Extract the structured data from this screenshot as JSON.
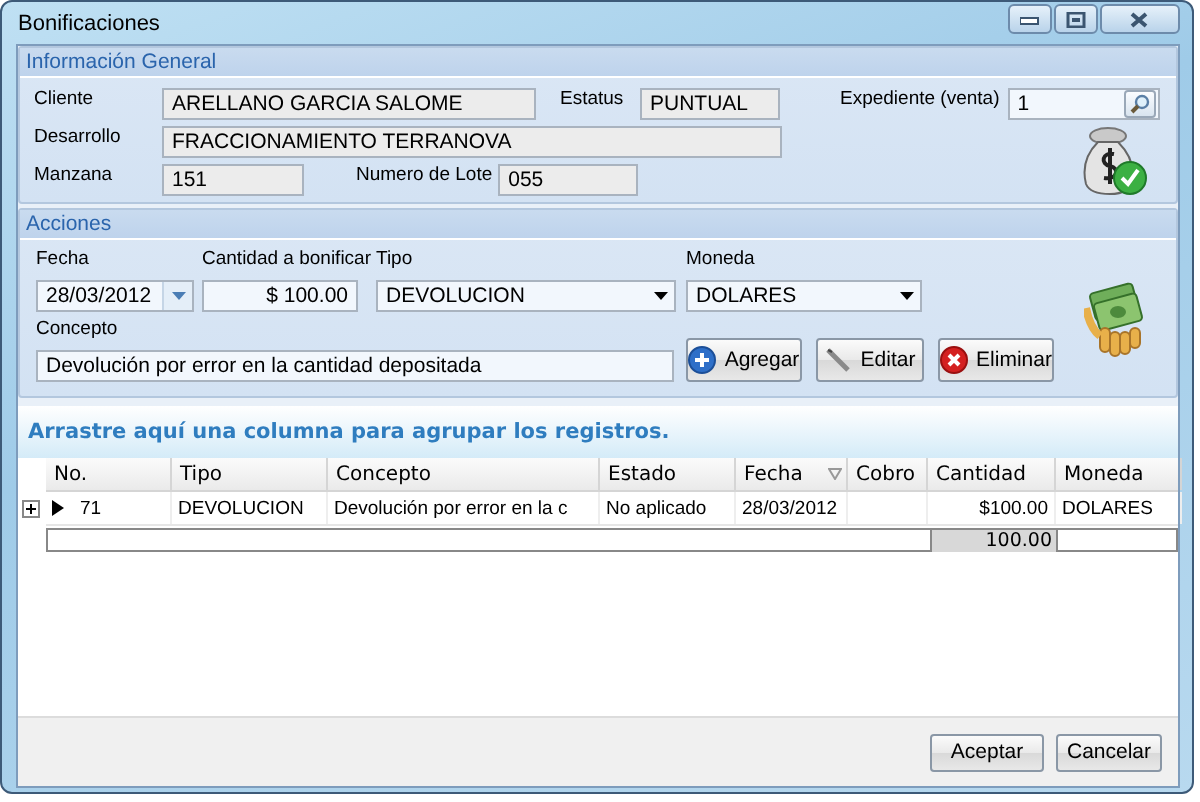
{
  "window": {
    "title": "Bonificaciones"
  },
  "informacion_general": {
    "title": "Información General",
    "fields": [
      {
        "label": "Cliente",
        "value": "ARELLANO GARCIA SALOME",
        "kind": "text",
        "readonly": true
      },
      {
        "label": "Estatus",
        "value": "PUNTUAL",
        "kind": "text",
        "readonly": true
      },
      {
        "label": "Expediente (venta)",
        "value": "1",
        "kind": "search",
        "readonly": false
      },
      {
        "label": "Desarrollo",
        "value": "FRACCIONAMIENTO TERRANOVA",
        "kind": "text",
        "readonly": true
      },
      {
        "label": "Manzana",
        "value": "151",
        "kind": "text",
        "readonly": true
      },
      {
        "label": "Numero de Lote",
        "value": "055",
        "kind": "text",
        "readonly": true
      }
    ]
  },
  "acciones": {
    "title": "Acciones",
    "fields": [
      {
        "label": "Fecha",
        "value": "28/03/2012",
        "kind": "date",
        "readonly": false
      },
      {
        "label": "Cantidad a bonificar",
        "value": "$ 100.00",
        "kind": "amount",
        "readonly": false
      },
      {
        "label": "Tipo",
        "value": "DEVOLUCION",
        "kind": "combo",
        "readonly": false
      },
      {
        "label": "Moneda",
        "value": "DOLARES",
        "kind": "combo",
        "readonly": false
      },
      {
        "label": "Concepto",
        "value": "Devolución por error en la cantidad depositada",
        "kind": "text",
        "readonly": false
      }
    ],
    "buttons": [
      {
        "label": "Agregar",
        "kind": "add"
      },
      {
        "label": "Editar",
        "kind": "edit"
      },
      {
        "label": "Eliminar",
        "kind": "delete"
      }
    ]
  },
  "grid": {
    "group_hint": "Arrastre aquí una columna para agrupar los registros.",
    "columns": [
      {
        "label": "No.",
        "sorted": false
      },
      {
        "label": "Tipo",
        "sorted": false
      },
      {
        "label": "Concepto",
        "sorted": false
      },
      {
        "label": "Estado",
        "sorted": false
      },
      {
        "label": "Fecha",
        "sorted": true
      },
      {
        "label": "Cobro",
        "sorted": false
      },
      {
        "label": "Cantidad",
        "sorted": false
      },
      {
        "label": "Moneda",
        "sorted": false
      }
    ],
    "rows": [
      {
        "selected": true,
        "expanded": false,
        "cells": [
          "71",
          "DEVOLUCION",
          "Devolución por error en la c",
          "No aplicado",
          "28/03/2012",
          null,
          "$100.00",
          "DOLARES"
        ]
      }
    ],
    "total": "100.00"
  },
  "buttons": [
    "Aceptar",
    "Cancelar"
  ]
}
